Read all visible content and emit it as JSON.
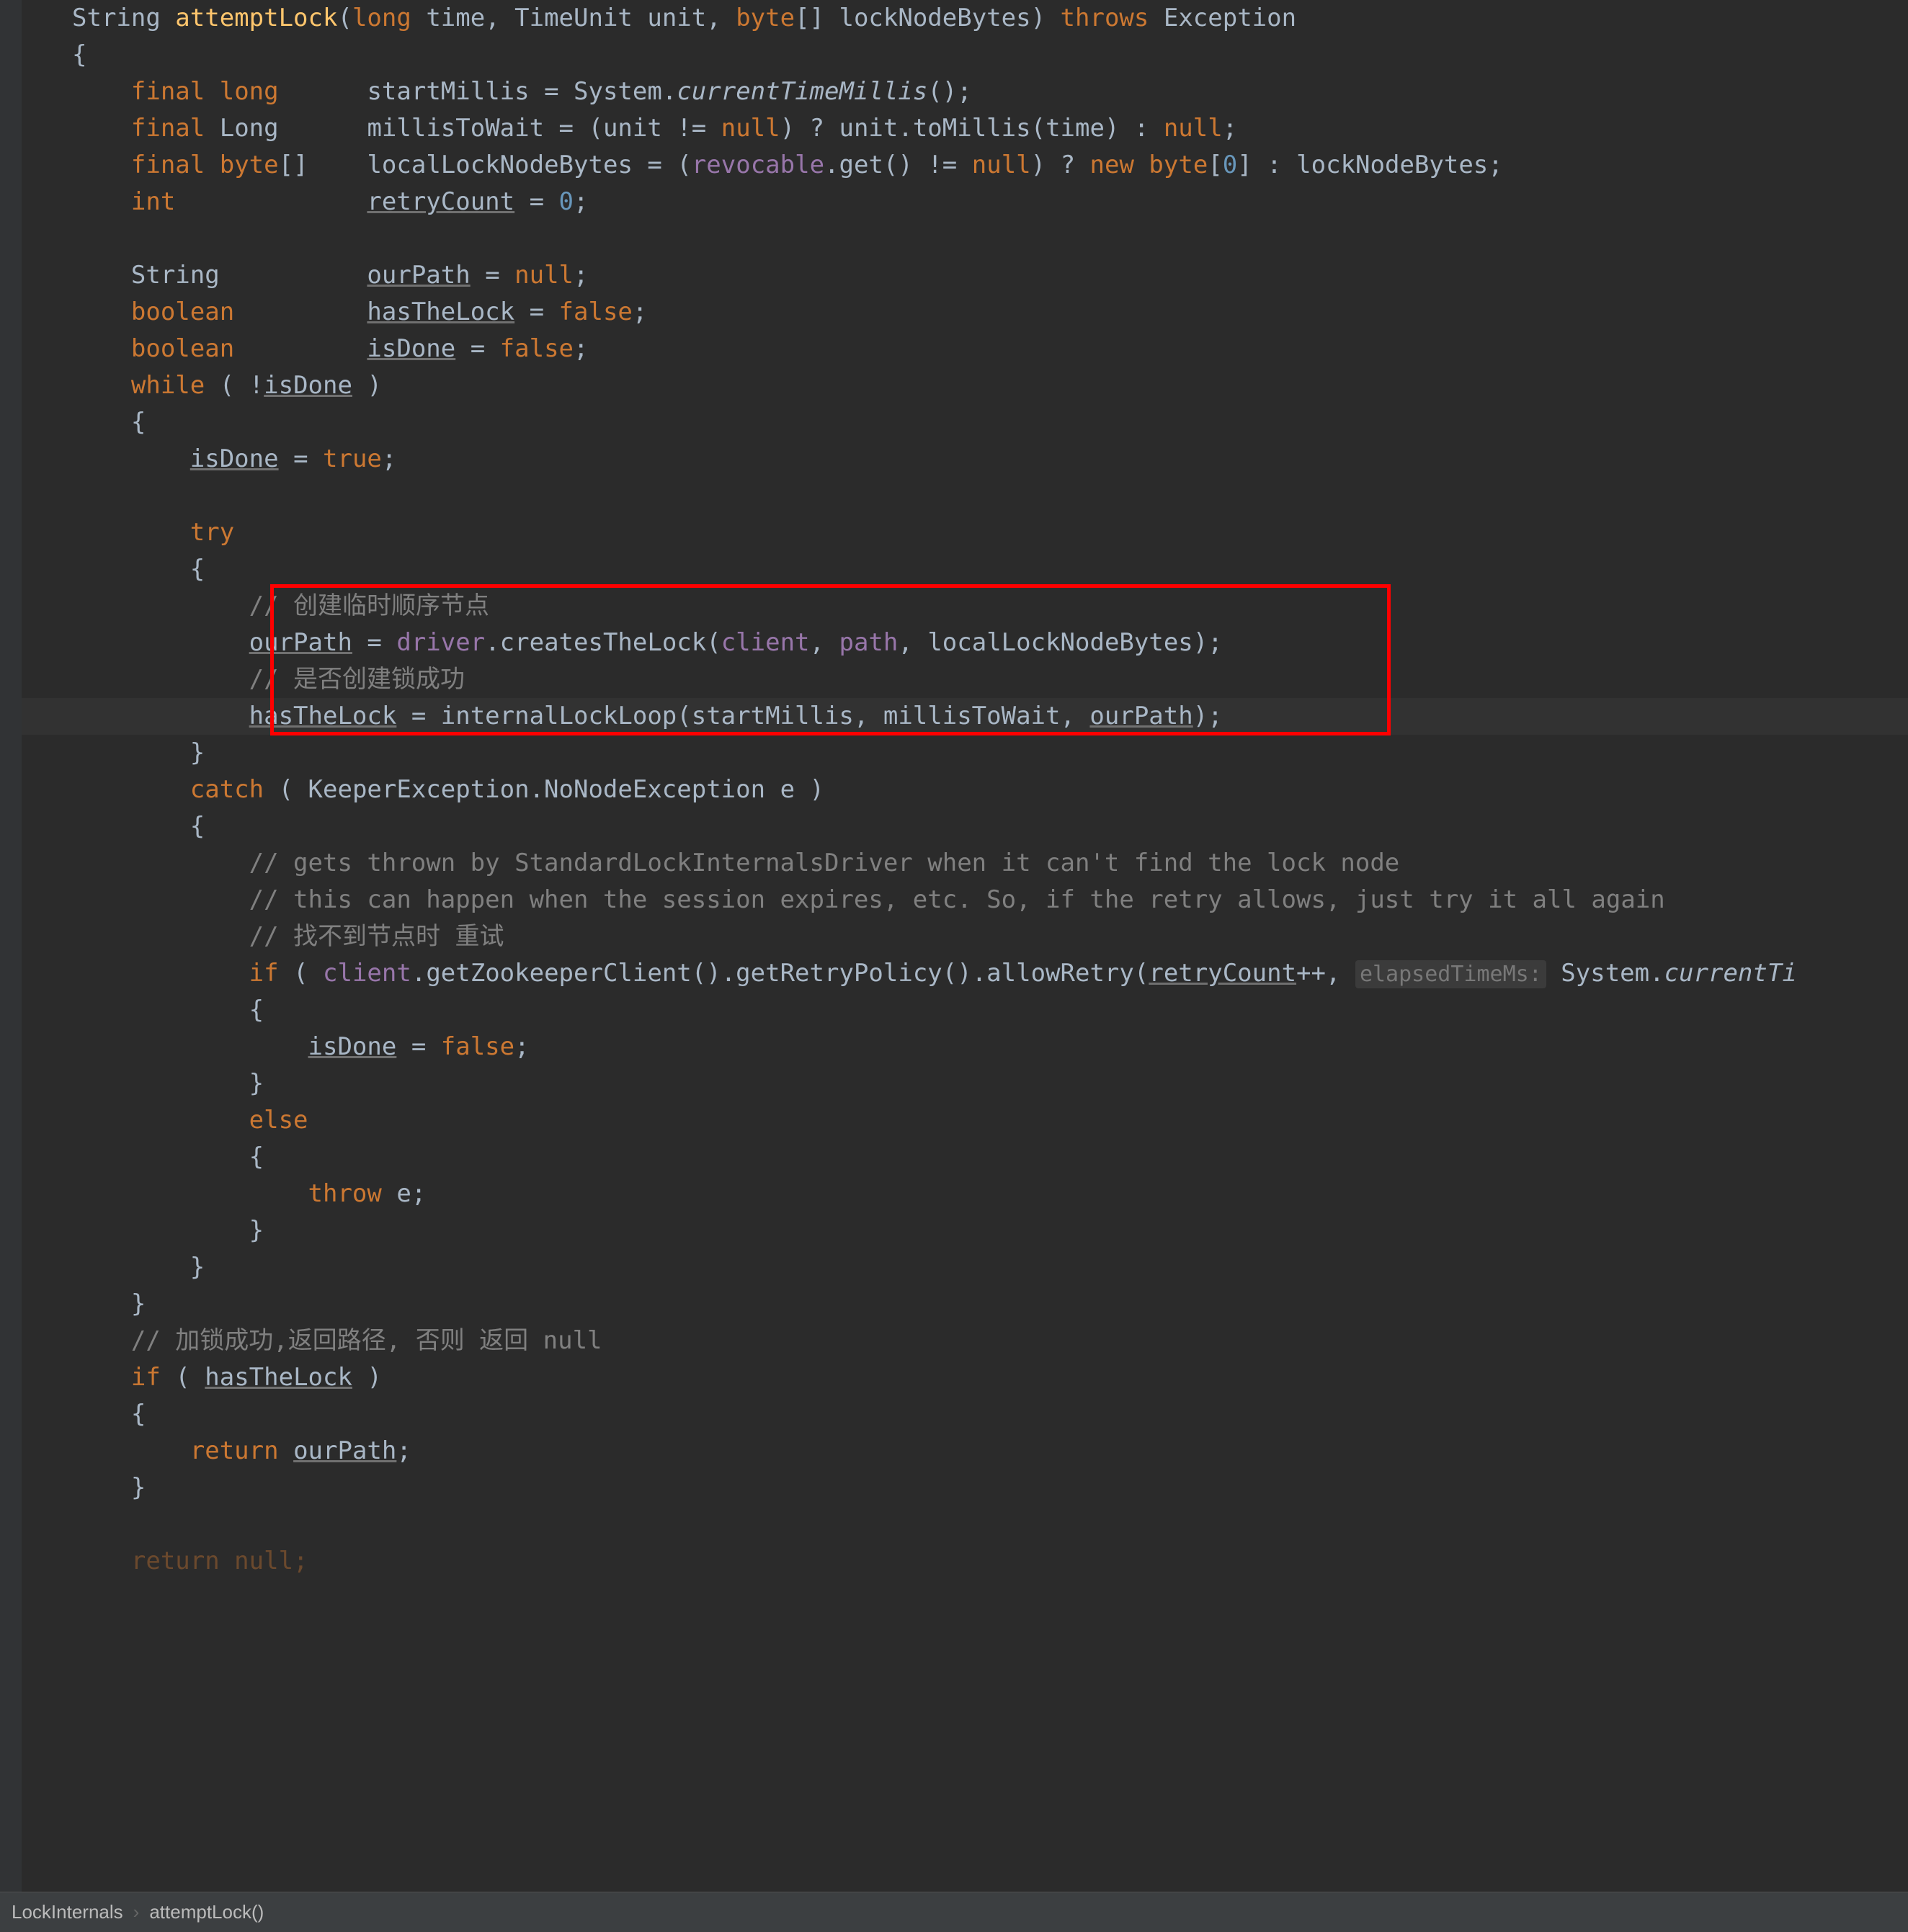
{
  "breadcrumbs": {
    "class": "LockInternals",
    "method": "attemptLock()"
  },
  "code": {
    "l1_String": "String ",
    "l1_method": "attemptLock",
    "l1_p1": "(",
    "l1_long": "long",
    "l1_time": " time, TimeUnit unit, ",
    "l1_byte": "byte",
    "l1_arr": "[] lockNodeBytes) ",
    "l1_throws": "throws",
    "l1_exc": " Exception",
    "l2_brace": "{",
    "l3_final": "final",
    "l3_long": " long",
    "l3_pad": "      ",
    "l3_var": "startMillis",
    "l3_eq": " = System.",
    "l3_ctm": "currentTimeMillis",
    "l3_end": "();",
    "l4_final": "final",
    "l4_Long": " Long",
    "l4_pad": "      ",
    "l4_var": "millisToWait",
    "l4_eq": " = (unit != ",
    "l4_null1": "null",
    "l4_q": ") ? unit.toMillis(time) : ",
    "l4_null2": "null",
    "l4_semi": ";",
    "l5_final": "final",
    "l5_byte": " byte",
    "l5_arr": "[]",
    "l5_pad": "    ",
    "l5_var": "localLockNodeBytes",
    "l5_eq": " = (",
    "l5_rev": "revocable",
    "l5_get": ".get() != ",
    "l5_null": "null",
    "l5_q": ") ? ",
    "l5_new": "new",
    "l5_byte2": " byte",
    "l5_zero": "[",
    "l5_zn": "0",
    "l5_close": "] : lockNodeBytes;",
    "l6_int": "int",
    "l6_pad": "             ",
    "l6_var": "retryCount",
    "l6_eq": " = ",
    "l6_zero": "0",
    "l6_semi": ";",
    "l8_String": "String",
    "l8_pad": "          ",
    "l8_var": "ourPath",
    "l8_eq": " = ",
    "l8_null": "null",
    "l8_semi": ";",
    "l9_bool": "boolean",
    "l9_pad": "         ",
    "l9_var": "hasTheLock",
    "l9_eq": " = ",
    "l9_false": "false",
    "l9_semi": ";",
    "l10_bool": "boolean",
    "l10_pad": "         ",
    "l10_var": "isDone",
    "l10_eq": " = ",
    "l10_false": "false",
    "l10_semi": ";",
    "l11_while": "while",
    "l11_open": " ( !",
    "l11_var": "isDone",
    "l11_close": " )",
    "l12_brace": "{",
    "l13_var": "isDone",
    "l13_eq": " = ",
    "l13_true": "true",
    "l13_semi": ";",
    "l15_try": "try",
    "l16_brace": "{",
    "l17_cmt": "// 创建临时顺序节点",
    "l18_var": "ourPath",
    "l18_eq": " = ",
    "l18_drv": "driver",
    "l18_call": ".createsTheLock(",
    "l18_client": "client",
    "l18_c": ", ",
    "l18_path": "path",
    "l18_c2": ", localLockNodeBytes);",
    "l19_cmt": "// 是否创建锁成功",
    "l20_var": "hasTheLock",
    "l20_eq": " = internalLockLoop(startMillis, millisToWait, ",
    "l20_our": "ourPath",
    "l20_end": ");",
    "l21_brace": "}",
    "l22_catch": "catch",
    "l22_rest": " ( KeeperException.NoNodeException e )",
    "l23_brace": "{",
    "l24_cmt": "// gets thrown by StandardLockInternalsDriver when it can't find the lock node",
    "l25_cmt": "// this can happen when the session expires, etc. So, if the retry allows, just try it all again",
    "l26_cmt": "// 找不到节点时 重试",
    "l27_if": "if",
    "l27_open": " ( ",
    "l27_client": "client",
    "l27_chain": ".getZookeeperClient().getRetryPolicy().allowRetry(",
    "l27_rc": "retryCount",
    "l27_pp": "++, ",
    "l27_inlay": "elapsedTimeMs:",
    "l27_sys": " System.",
    "l27_ctm": "currentTi",
    "l28_brace": "{",
    "l29_var": "isDone",
    "l29_eq": " = ",
    "l29_false": "false",
    "l29_semi": ";",
    "l30_brace": "}",
    "l31_else": "else",
    "l32_brace": "{",
    "l33_throw": "throw",
    "l33_e": " e;",
    "l34_brace": "}",
    "l35_brace": "}",
    "l36_brace": "}",
    "l37_cmt": "// 加锁成功,返回路径, 否则 返回 null",
    "l38_if": "if",
    "l38_open": " ( ",
    "l38_var": "hasTheLock",
    "l38_close": " )",
    "l39_brace": "{",
    "l40_return": "return",
    "l40_sp": " ",
    "l40_var": "ourPath",
    "l40_semi": ";",
    "l41_brace": "}",
    "l43_return": "return null;"
  }
}
